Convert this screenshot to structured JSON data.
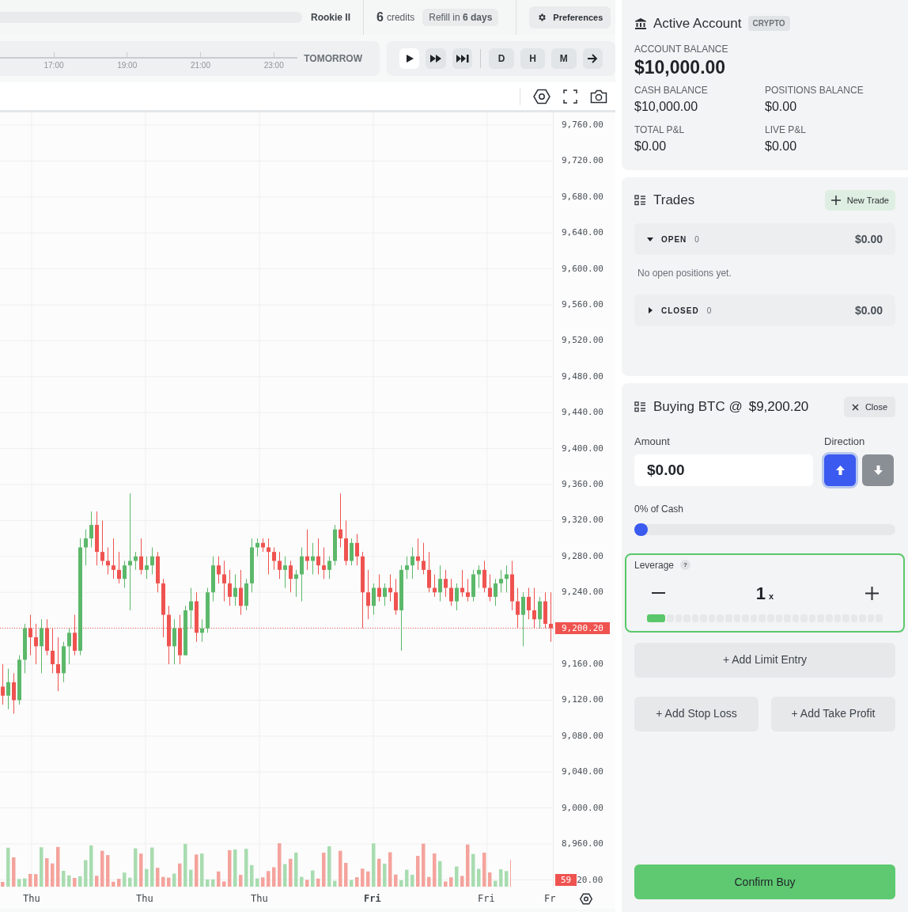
{
  "header": {
    "rank": "Rookie II",
    "credits_count": "6",
    "credits_label": "credits",
    "refill": "Refill in **6 days**",
    "preferences": "Preferences"
  },
  "timeline": {
    "ticks": [
      "17:00",
      "19:00",
      "21:00",
      "23:00"
    ],
    "end_label": "TOMORROW"
  },
  "playback": [
    {
      "kind": "play",
      "selected": true
    },
    {
      "kind": "fast",
      "selected": false
    },
    {
      "kind": "skip",
      "selected": false
    }
  ],
  "intervals": [
    "D",
    "H",
    "M"
  ],
  "chart": {
    "y_axis": [
      {
        "kind": "price",
        "text": "9,200.20"
      },
      {
        "kind": "volume",
        "badge": "59",
        "text": "20.00"
      }
    ],
    "chart_data": {
      "type": "candlestick",
      "grid": true,
      "ref_lines": [
        {
          "axis": "y",
          "value": 9200.2
        }
      ],
      "categories": [
        null,
        null,
        null,
        null,
        null,
        null,
        null,
        null,
        null,
        null,
        null,
        null,
        null,
        null,
        null,
        null,
        null,
        null,
        null,
        null,
        null,
        null,
        null,
        null,
        null,
        null,
        null,
        null,
        null,
        null,
        null,
        null,
        null,
        null,
        null,
        null,
        null,
        null,
        null,
        null,
        null,
        null,
        null,
        null,
        null,
        null,
        null,
        null,
        null,
        null,
        null,
        null,
        null,
        null,
        null,
        null,
        null,
        null,
        null,
        null,
        null,
        null,
        null,
        null,
        null,
        null,
        null,
        null,
        null,
        null,
        null,
        null,
        null,
        null,
        null,
        null,
        null,
        null,
        null,
        null,
        null,
        null,
        null,
        null,
        null,
        null,
        null,
        null,
        null,
        null,
        null,
        null,
        null,
        null,
        null,
        null,
        null,
        null,
        null,
        null
      ],
      "ylim": [
        8910.7,
        9774.1
      ],
      "yticks": [
        {
          "value": 9760,
          "label": "9,760.00"
        },
        {
          "value": 9720,
          "label": "9,720.00"
        },
        {
          "value": 9680,
          "label": "9,680.00"
        },
        {
          "value": 9640,
          "label": "9,640.00"
        },
        {
          "value": 9600,
          "label": "9,600.00"
        },
        {
          "value": 9560,
          "label": "9,560.00"
        },
        {
          "value": 9520,
          "label": "9,520.00"
        },
        {
          "value": 9480,
          "label": "9,480.00"
        },
        {
          "value": 9440,
          "label": "9,440.00"
        },
        {
          "value": 9400,
          "label": "9,400.00"
        },
        {
          "value": 9360,
          "label": "9,360.00"
        },
        {
          "value": 9320,
          "label": "9,320.00"
        },
        {
          "value": 9280,
          "label": "9,280.00"
        },
        {
          "value": 9240,
          "label": "9,240.00"
        },
        {
          "value": 9160,
          "label": "9,160.00"
        },
        {
          "value": 9120,
          "label": "9,120.00"
        },
        {
          "value": 9080,
          "label": "9,080.00"
        },
        {
          "value": 9040,
          "label": "9,040.00"
        },
        {
          "value": 9000,
          "label": "9,000.00"
        },
        {
          "value": 8960,
          "label": "8,960.00"
        }
      ],
      "ohlc": [
        [
          9135,
          9160,
          9115,
          9125
        ],
        [
          9125,
          9155,
          9110,
          9140
        ],
        [
          9140,
          9150,
          9105,
          9120
        ],
        [
          9120,
          9170,
          9115,
          9165
        ],
        [
          9165,
          9205,
          9150,
          9200
        ],
        [
          9200,
          9215,
          9170,
          9190
        ],
        [
          9190,
          9205,
          9160,
          9180
        ],
        [
          9180,
          9210,
          9150,
          9200
        ],
        [
          9200,
          9210,
          9170,
          9175
        ],
        [
          9175,
          9200,
          9150,
          9160
        ],
        [
          9160,
          9190,
          9130,
          9150
        ],
        [
          9150,
          9185,
          9140,
          9180
        ],
        [
          9180,
          9200,
          9160,
          9195
        ],
        [
          9195,
          9215,
          9170,
          9175
        ],
        [
          9175,
          9300,
          9170,
          9290
        ],
        [
          9290,
          9310,
          9270,
          9300
        ],
        [
          9300,
          9330,
          9290,
          9315
        ],
        [
          9315,
          9330,
          9270,
          9285
        ],
        [
          9285,
          9320,
          9270,
          9275
        ],
        [
          9275,
          9290,
          9260,
          9270
        ],
        [
          9270,
          9300,
          9255,
          9265
        ],
        [
          9265,
          9285,
          9250,
          9255
        ],
        [
          9255,
          9275,
          9245,
          9270
        ],
        [
          9270,
          9350,
          9220,
          9275
        ],
        [
          9275,
          9285,
          9265,
          9280
        ],
        [
          9280,
          9300,
          9260,
          9265
        ],
        [
          9265,
          9280,
          9255,
          9270
        ],
        [
          9270,
          9290,
          9260,
          9280
        ],
        [
          9280,
          9285,
          9240,
          9250
        ],
        [
          9250,
          9255,
          9190,
          9215
        ],
        [
          9215,
          9225,
          9160,
          9180
        ],
        [
          9180,
          9210,
          9160,
          9200
        ],
        [
          9200,
          9215,
          9160,
          9170
        ],
        [
          9170,
          9225,
          9170,
          9220
        ],
        [
          9220,
          9245,
          9200,
          9230
        ],
        [
          9230,
          9240,
          9185,
          9195
        ],
        [
          9195,
          9210,
          9185,
          9200
        ],
        [
          9200,
          9245,
          9195,
          9240
        ],
        [
          9240,
          9280,
          9230,
          9270
        ],
        [
          9270,
          9280,
          9250,
          9260
        ],
        [
          9260,
          9275,
          9230,
          9250
        ],
        [
          9250,
          9265,
          9225,
          9235
        ],
        [
          9235,
          9260,
          9225,
          9245
        ],
        [
          9245,
          9265,
          9215,
          9225
        ],
        [
          9225,
          9255,
          9220,
          9250
        ],
        [
          9250,
          9300,
          9240,
          9290
        ],
        [
          9290,
          9300,
          9280,
          9295
        ],
        [
          9295,
          9300,
          9285,
          9290
        ],
        [
          9290,
          9300,
          9260,
          9285
        ],
        [
          9285,
          9290,
          9265,
          9275
        ],
        [
          9275,
          9285,
          9255,
          9265
        ],
        [
          9265,
          9280,
          9245,
          9270
        ],
        [
          9270,
          9275,
          9240,
          9255
        ],
        [
          9255,
          9265,
          9235,
          9260
        ],
        [
          9260,
          9290,
          9230,
          9280
        ],
        [
          9280,
          9310,
          9265,
          9275
        ],
        [
          9275,
          9295,
          9260,
          9280
        ],
        [
          9280,
          9300,
          9260,
          9270
        ],
        [
          9270,
          9290,
          9255,
          9265
        ],
        [
          9265,
          9280,
          9255,
          9275
        ],
        [
          9275,
          9315,
          9270,
          9310
        ],
        [
          9310,
          9350,
          9290,
          9300
        ],
        [
          9300,
          9320,
          9270,
          9275
        ],
        [
          9275,
          9300,
          9270,
          9295
        ],
        [
          9295,
          9305,
          9270,
          9280
        ],
        [
          9280,
          9285,
          9200,
          9240
        ],
        [
          9240,
          9265,
          9210,
          9225
        ],
        [
          9225,
          9250,
          9215,
          9245
        ],
        [
          9245,
          9260,
          9230,
          9235
        ],
        [
          9235,
          9250,
          9225,
          9245
        ],
        [
          9245,
          9260,
          9230,
          9240
        ],
        [
          9240,
          9255,
          9215,
          9220
        ],
        [
          9220,
          9270,
          9175,
          9265
        ],
        [
          9265,
          9280,
          9255,
          9270
        ],
        [
          9270,
          9290,
          9255,
          9280
        ],
        [
          9280,
          9300,
          9265,
          9275
        ],
        [
          9275,
          9295,
          9260,
          9265
        ],
        [
          9265,
          9285,
          9240,
          9245
        ],
        [
          9245,
          9260,
          9235,
          9240
        ],
        [
          9240,
          9270,
          9230,
          9255
        ],
        [
          9255,
          9265,
          9235,
          9245
        ],
        [
          9245,
          9255,
          9225,
          9230
        ],
        [
          9230,
          9250,
          9220,
          9245
        ],
        [
          9245,
          9265,
          9235,
          9240
        ],
        [
          9240,
          9255,
          9230,
          9235
        ],
        [
          9235,
          9265,
          9230,
          9260
        ],
        [
          9260,
          9270,
          9245,
          9265
        ],
        [
          9265,
          9275,
          9240,
          9245
        ],
        [
          9245,
          9260,
          9230,
          9235
        ],
        [
          9235,
          9255,
          9225,
          9250
        ],
        [
          9250,
          9265,
          9240,
          9255
        ],
        [
          9255,
          9270,
          9240,
          9260
        ],
        [
          9260,
          9275,
          9220,
          9230
        ],
        [
          9230,
          9245,
          9200,
          9215
        ],
        [
          9215,
          9240,
          9180,
          9235
        ],
        [
          9235,
          9245,
          9210,
          9220
        ],
        [
          9220,
          9245,
          9200,
          9210
        ],
        [
          9210,
          9235,
          9200,
          9230
        ],
        [
          9230,
          9240,
          9200,
          9205
        ],
        [
          9205,
          9240,
          9185,
          9200
        ]
      ]
    },
    "x_labels": [
      {
        "text": "Thu",
        "emphasis": false
      },
      {
        "text": "Thu",
        "emphasis": false
      },
      {
        "text": "Thu",
        "emphasis": false
      },
      {
        "text": "Fri",
        "emphasis": true
      },
      {
        "text": "Fri",
        "emphasis": false
      },
      {
        "text": "Fr",
        "emphasis": false
      }
    ]
  },
  "account": {
    "title": "Active Account",
    "badge": "CRYPTO",
    "balance_label": "ACCOUNT BALANCE",
    "balance": "$10,000.00",
    "stats": [
      {
        "label": "CASH BALANCE",
        "value": "$10,000.00"
      },
      {
        "label": "POSITIONS BALANCE",
        "value": "$0.00"
      },
      {
        "label": "TOTAL P&L",
        "value": "$0.00"
      },
      {
        "label": "LIVE P&L",
        "value": "$0.00"
      }
    ]
  },
  "trades": {
    "title": "Trades",
    "new_button": "New Trade",
    "groups": [
      {
        "label": "OPEN",
        "count": "0",
        "total": "$0.00",
        "expanded": true,
        "empty_text": "No open positions yet."
      },
      {
        "label": "CLOSED",
        "count": "0",
        "total": "$0.00",
        "expanded": false
      }
    ]
  },
  "order": {
    "title": "Buying BTC @",
    "price": "$9,200.20",
    "close": "Close",
    "amount_label": "Amount",
    "amount": "$0.00",
    "direction_label": "Direction",
    "directions": [
      {
        "kind": "up",
        "selected": true
      },
      {
        "kind": "down",
        "selected": false
      }
    ],
    "cash_label": "0% of Cash",
    "cash_slider": {
      "level": 0
    },
    "leverage": {
      "label": "Leverage",
      "help": "?",
      "value": "1",
      "unit": "x",
      "level": 0.04
    },
    "limit_button": "+ Add Limit Entry",
    "stop_button": "+ Add Stop Loss",
    "profit_button": "+ Add Take Profit",
    "confirm": "Confirm Buy"
  }
}
